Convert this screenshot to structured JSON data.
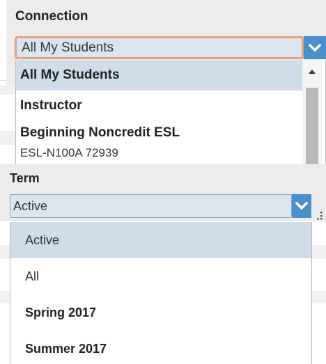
{
  "connection": {
    "label": "Connection",
    "selected": "All My Students",
    "options": [
      {
        "label": "All My Students",
        "bold": true,
        "selected": true
      },
      {
        "label": "Instructor",
        "bold": true,
        "selected": false
      },
      {
        "label": "Beginning Noncredit ESL",
        "bold": true,
        "selected": false
      },
      {
        "label": "ESL-N100A 72939",
        "bold": false,
        "selected": false
      }
    ]
  },
  "term": {
    "label": "Term",
    "selected": "Active",
    "options": [
      {
        "label": "Active",
        "bold": false,
        "selected": true
      },
      {
        "label": "All",
        "bold": false,
        "selected": false
      },
      {
        "label": "Spring 2017",
        "bold": true,
        "selected": false
      },
      {
        "label": "Summer 2017",
        "bold": true,
        "selected": false
      }
    ]
  },
  "colors": {
    "accent": "#4a90cc",
    "selected_row": "#cfddeb",
    "select_bg": "#dbe5f0",
    "focus_border": "#e8a27f"
  },
  "icons": {
    "dropdown": "chevron-down-icon",
    "scroll_up": "triangle-up-icon",
    "resize": "resize-grip-icon"
  }
}
